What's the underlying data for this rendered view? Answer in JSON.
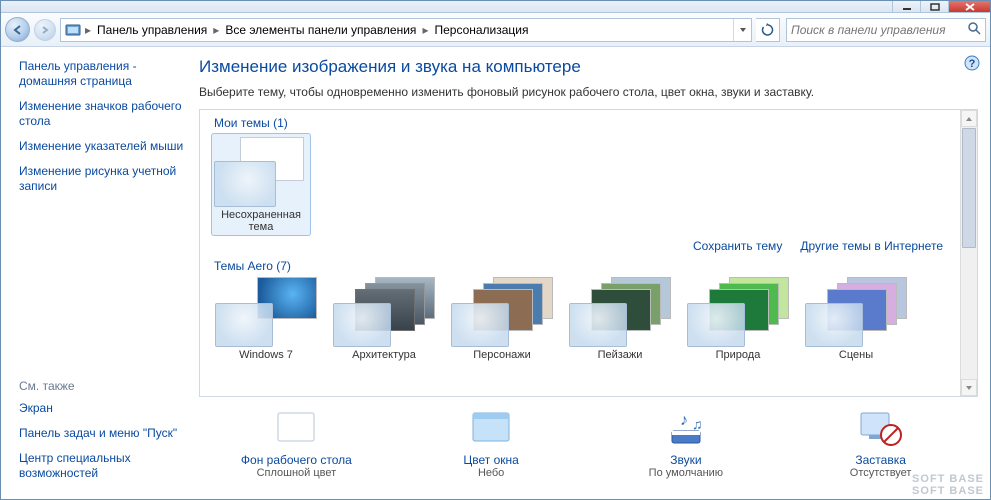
{
  "breadcrumb": {
    "items": [
      "Панель управления",
      "Все элементы панели управления",
      "Персонализация"
    ]
  },
  "search": {
    "placeholder": "Поиск в панели управления"
  },
  "sidebar": {
    "home": "Панель управления - домашняя страница",
    "links": [
      "Изменение значков рабочего стола",
      "Изменение указателей мыши",
      "Изменение рисунка учетной записи"
    ],
    "see_also_label": "См. также",
    "see_also": [
      "Экран",
      "Панель задач и меню \"Пуск\"",
      "Центр специальных возможностей"
    ]
  },
  "content": {
    "title": "Изменение изображения и звука на компьютере",
    "description": "Выберите тему, чтобы одновременно изменить фоновый рисунок рабочего стола, цвет окна, звуки и заставку.",
    "my_themes_label": "Мои темы (1)",
    "my_themes": [
      {
        "label": "Несохраненная тема"
      }
    ],
    "actions": {
      "save": "Сохранить тему",
      "more": "Другие темы в Интернете"
    },
    "aero_label": "Темы Aero (7)",
    "aero_themes": [
      {
        "label": "Windows 7"
      },
      {
        "label": "Архитектура"
      },
      {
        "label": "Персонажи"
      },
      {
        "label": "Пейзажи"
      },
      {
        "label": "Природа"
      },
      {
        "label": "Сцены"
      }
    ],
    "settings": {
      "background": {
        "link": "Фон рабочего стола",
        "value": "Сплошной цвет"
      },
      "color": {
        "link": "Цвет окна",
        "value": "Небо"
      },
      "sounds": {
        "link": "Звуки",
        "value": "По умолчанию"
      },
      "screensaver": {
        "link": "Заставка",
        "value": "Отсутствует"
      }
    }
  },
  "watermark": "SOFT BASE"
}
